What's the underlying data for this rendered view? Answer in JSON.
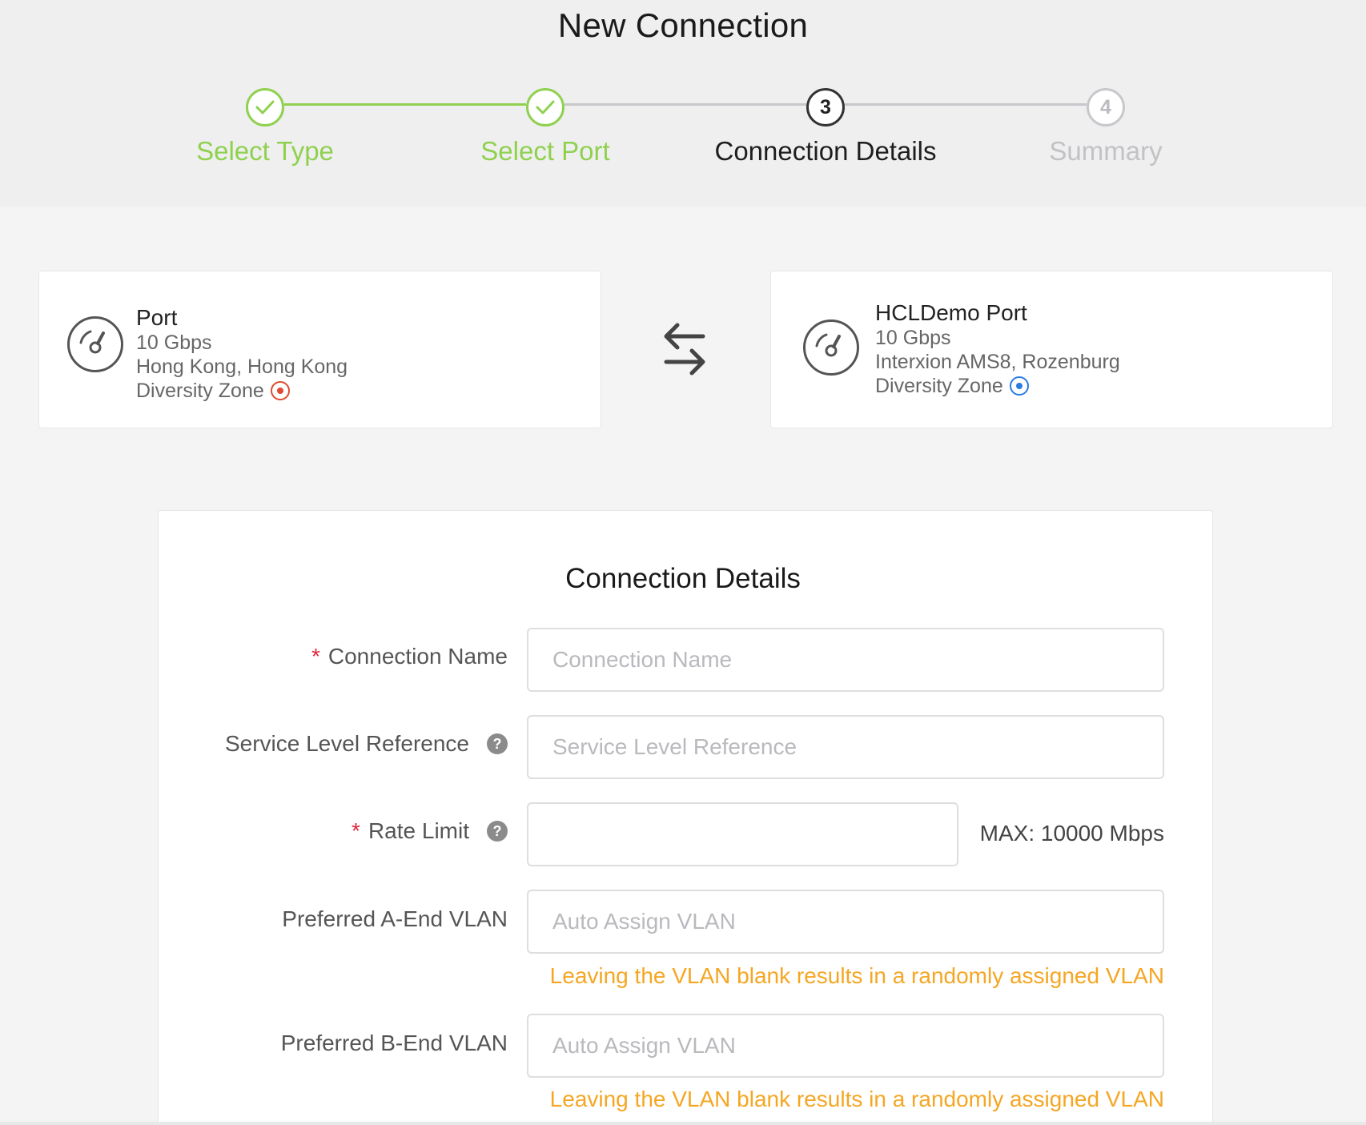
{
  "page_title": "New Connection",
  "colors": {
    "step_done": "#8fd14f",
    "step_active": "#333333",
    "step_pending": "#c8c8cc",
    "required_star": "#e0263a",
    "vlan_hint": "#f5a623",
    "zone_a": "#e04a2f",
    "zone_b": "#2a7be4"
  },
  "stepper": {
    "steps": [
      {
        "number": "1",
        "label": "Select Type",
        "state": "done",
        "icon": "check-icon"
      },
      {
        "number": "2",
        "label": "Select Port",
        "state": "done",
        "icon": "check-icon"
      },
      {
        "number": "3",
        "label": "Connection Details",
        "state": "active"
      },
      {
        "number": "4",
        "label": "Summary",
        "state": "pending"
      }
    ]
  },
  "a_end": {
    "name": "Port",
    "speed": "10 Gbps",
    "location": "Hong Kong, Hong Kong",
    "zone_label": "Diversity Zone",
    "zone_color": "red",
    "icon": "speedometer-icon"
  },
  "swap_icon": "swap-arrows-icon",
  "b_end": {
    "name": "HCLDemo Port",
    "speed": "10 Gbps",
    "location": "Interxion AMS8, Rozenburg",
    "zone_label": "Diversity Zone",
    "zone_color": "blue",
    "icon": "speedometer-icon"
  },
  "details": {
    "title": "Connection Details",
    "required_mark": "*",
    "connection_name": {
      "label": "Connection Name",
      "placeholder": "Connection Name",
      "value": ""
    },
    "service_level": {
      "label": "Service Level Reference",
      "placeholder": "Service Level Reference",
      "value": "",
      "help": "?"
    },
    "rate_limit": {
      "label": "Rate Limit",
      "value": "",
      "max_note": "MAX: 10000 Mbps",
      "help": "?"
    },
    "a_vlan": {
      "label": "Preferred A-End VLAN",
      "placeholder": "Auto Assign VLAN",
      "hint": "Leaving the VLAN blank results in a randomly assigned VLAN"
    },
    "b_vlan": {
      "label": "Preferred B-End VLAN",
      "placeholder": "Auto Assign VLAN",
      "hint": "Leaving the VLAN blank results in a randomly assigned VLAN"
    }
  }
}
